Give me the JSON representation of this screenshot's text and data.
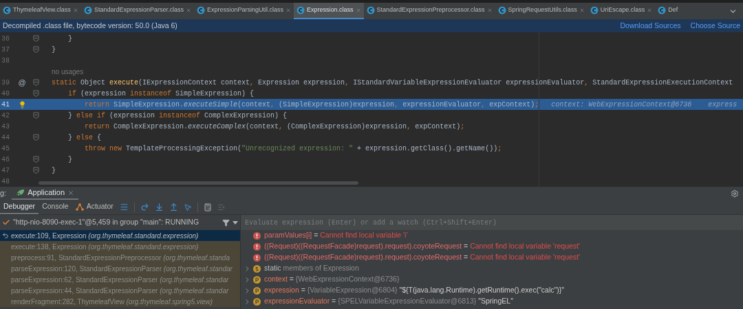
{
  "editor_tabs": [
    {
      "label": "ThymeleafView.class",
      "selected": false
    },
    {
      "label": "StandardExpressionParser.class",
      "selected": false
    },
    {
      "label": "ExpressionParsingUtil.class",
      "selected": false
    },
    {
      "label": "Expression.class",
      "selected": true
    },
    {
      "label": "StandardExpressionPreprocessor.class",
      "selected": false
    },
    {
      "label": "SpringRequestUtils.class",
      "selected": false
    },
    {
      "label": "UriEscape.class",
      "selected": false
    },
    {
      "label": "Def",
      "selected": false
    }
  ],
  "info_bar": {
    "message": "Decompiled .class file, bytecode version: 50.0 (Java 6)",
    "links": [
      "Download Sources",
      "Choose Source"
    ]
  },
  "editor": {
    "lines": [
      {
        "kind": "code",
        "number": "36",
        "fold": true,
        "current": false,
        "segments": [
          {
            "kind": "plain",
            "t": "    }"
          }
        ]
      },
      {
        "kind": "code",
        "number": "37",
        "fold": true,
        "current": false,
        "segments": [
          {
            "kind": "plain",
            "t": "}"
          }
        ]
      },
      {
        "kind": "code",
        "number": "38",
        "fold": false,
        "current": false
      },
      {
        "kind": "usages",
        "text": "no usages"
      },
      {
        "kind": "code",
        "number": "39",
        "fold": true,
        "current": false,
        "gutter_mark": "@",
        "segments": [
          {
            "kind": "kw",
            "t": "static "
          },
          {
            "kind": "plain",
            "t": "Object "
          },
          {
            "kind": "decl",
            "t": "execute"
          },
          {
            "kind": "plain",
            "t": "(IExpressionContext context"
          },
          {
            "kind": "punct",
            "t": ", "
          },
          {
            "kind": "plain",
            "t": "Expression expression"
          },
          {
            "kind": "punct",
            "t": ", "
          },
          {
            "kind": "plain",
            "t": "IStandardVariableExpressionEvaluator expressionEvaluator"
          },
          {
            "kind": "punct",
            "t": ", "
          },
          {
            "kind": "plain",
            "t": "StandardExpressionExecutionContext"
          }
        ]
      },
      {
        "kind": "code",
        "number": "40",
        "fold": true,
        "current": false,
        "segments": [
          {
            "kind": "kw",
            "t": "    if "
          },
          {
            "kind": "plain",
            "t": "(expression "
          },
          {
            "kind": "kw",
            "t": "instanceof "
          },
          {
            "kind": "plain",
            "t": "SimpleExpression) {"
          }
        ]
      },
      {
        "kind": "code",
        "number": "41",
        "fold": false,
        "current": true,
        "segments": [
          {
            "kind": "kw",
            "t": "        return "
          },
          {
            "kind": "plain",
            "t": "SimpleExpression."
          },
          {
            "kind": "call",
            "t": "executeSimple"
          },
          {
            "kind": "plain",
            "t": "(context"
          },
          {
            "kind": "punct",
            "t": ", "
          },
          {
            "kind": "plain",
            "t": "(SimpleExpression)expression"
          },
          {
            "kind": "punct",
            "t": ", "
          },
          {
            "kind": "plain",
            "t": "expressionEvaluator"
          },
          {
            "kind": "punct",
            "t": ", "
          },
          {
            "kind": "plain",
            "t": "expContext)"
          },
          {
            "kind": "punct",
            "t": ";"
          },
          {
            "kind": "hint",
            "t": "   context: WebExpressionContext@6736    express"
          }
        ]
      },
      {
        "kind": "code",
        "number": "42",
        "fold": true,
        "current": false,
        "segments": [
          {
            "kind": "plain",
            "t": "    } "
          },
          {
            "kind": "kw",
            "t": "else if "
          },
          {
            "kind": "plain",
            "t": "(expression "
          },
          {
            "kind": "kw",
            "t": "instanceof "
          },
          {
            "kind": "plain",
            "t": "ComplexExpression) {"
          }
        ]
      },
      {
        "kind": "code",
        "number": "43",
        "fold": false,
        "current": false,
        "segments": [
          {
            "kind": "kw",
            "t": "        return "
          },
          {
            "kind": "plain",
            "t": "ComplexExpression."
          },
          {
            "kind": "call",
            "t": "executeComplex"
          },
          {
            "kind": "plain",
            "t": "(context"
          },
          {
            "kind": "punct",
            "t": ", "
          },
          {
            "kind": "plain",
            "t": "(ComplexExpression)expression"
          },
          {
            "kind": "punct",
            "t": ", "
          },
          {
            "kind": "plain",
            "t": "expContext)"
          },
          {
            "kind": "punct",
            "t": ";"
          }
        ]
      },
      {
        "kind": "code",
        "number": "44",
        "fold": true,
        "current": false,
        "segments": [
          {
            "kind": "plain",
            "t": "    } "
          },
          {
            "kind": "kw",
            "t": "else "
          },
          {
            "kind": "plain",
            "t": "{"
          }
        ]
      },
      {
        "kind": "code",
        "number": "45",
        "fold": false,
        "current": false,
        "segments": [
          {
            "kind": "kw",
            "t": "        throw new "
          },
          {
            "kind": "plain",
            "t": "TemplateProcessingException("
          },
          {
            "kind": "str",
            "t": "\"Unrecognized expression: \""
          },
          {
            "kind": "plain",
            "t": " + expression.getClass().getName())"
          },
          {
            "kind": "punct",
            "t": ";"
          }
        ]
      },
      {
        "kind": "code",
        "number": "46",
        "fold": true,
        "current": false,
        "segments": [
          {
            "kind": "plain",
            "t": "    }"
          }
        ]
      },
      {
        "kind": "code",
        "number": "47",
        "fold": true,
        "current": false,
        "segments": [
          {
            "kind": "plain",
            "t": "}"
          }
        ]
      },
      {
        "kind": "code",
        "number": "48",
        "fold": false,
        "current": false
      }
    ]
  },
  "debug": {
    "title_prefix": "g:",
    "session_tab": {
      "label": "Application",
      "selected": true
    },
    "tabs": [
      {
        "label": "Debugger",
        "selected": true,
        "kind": "plain"
      },
      {
        "label": "Console",
        "selected": false,
        "kind": "plain"
      },
      {
        "label": "Actuator",
        "selected": false,
        "kind": "actuator"
      }
    ],
    "thread": "\"http-nio-8090-exec-1\"@5,459 in group \"main\": RUNNING",
    "frames": [
      {
        "method": "execute:109, Expression",
        "package": "(org.thymeleaf.standard.expression)",
        "selected": true
      },
      {
        "method": "execute:138, Expression",
        "package": "(org.thymeleaf.standard.expression)",
        "selected": false
      },
      {
        "method": "preprocess:91, StandardExpressionPreprocessor",
        "package": "(org.thymeleaf.standa",
        "selected": false
      },
      {
        "method": "parseExpression:120, StandardExpressionParser",
        "package": "(org.thymeleaf.standar",
        "selected": false
      },
      {
        "method": "parseExpression:62, StandardExpressionParser",
        "package": "(org.thymeleaf.standar",
        "selected": false
      },
      {
        "method": "parseExpression:44, StandardExpressionParser",
        "package": "(org.thymeleaf.standar",
        "selected": false
      },
      {
        "method": "renderFragment:282, ThymeleafView",
        "package": "(org.thymeleaf.spring5.view)",
        "selected": false
      }
    ],
    "evaluate": {
      "placeholder": "Evaluate expression (Enter) or add a watch (Ctrl+Shift+Enter)"
    },
    "variables": [
      {
        "kind": "error",
        "name": "paramValues[i]",
        "op": "=",
        "value": "Cannot find local variable 'i'"
      },
      {
        "kind": "error",
        "name": "((Request)((RequestFacade)request).request).coyoteRequest",
        "op": "=",
        "value": "Cannot find local variable 'request'"
      },
      {
        "kind": "error",
        "name": "((Request)((RequestFacade)request).request).coyoteRequest",
        "op": "=",
        "value": "Cannot find local variable 'request'"
      },
      {
        "kind": "static",
        "name": "static",
        "value": "members of Expression"
      },
      {
        "kind": "field",
        "name": "context",
        "op": "=",
        "value": "{WebExpressionContext@6736}"
      },
      {
        "kind": "field",
        "name": "expression",
        "op": "=",
        "value": "{VariableExpression@6804}",
        "string": "\"${T(java.lang.Runtime).getRuntime().exec(\"calc\")}\""
      },
      {
        "kind": "field",
        "name": "expressionEvaluator",
        "op": "=",
        "value": "{SPELVariableExpressionEvaluator@6813}",
        "string": "\"SpringEL\""
      }
    ]
  }
}
